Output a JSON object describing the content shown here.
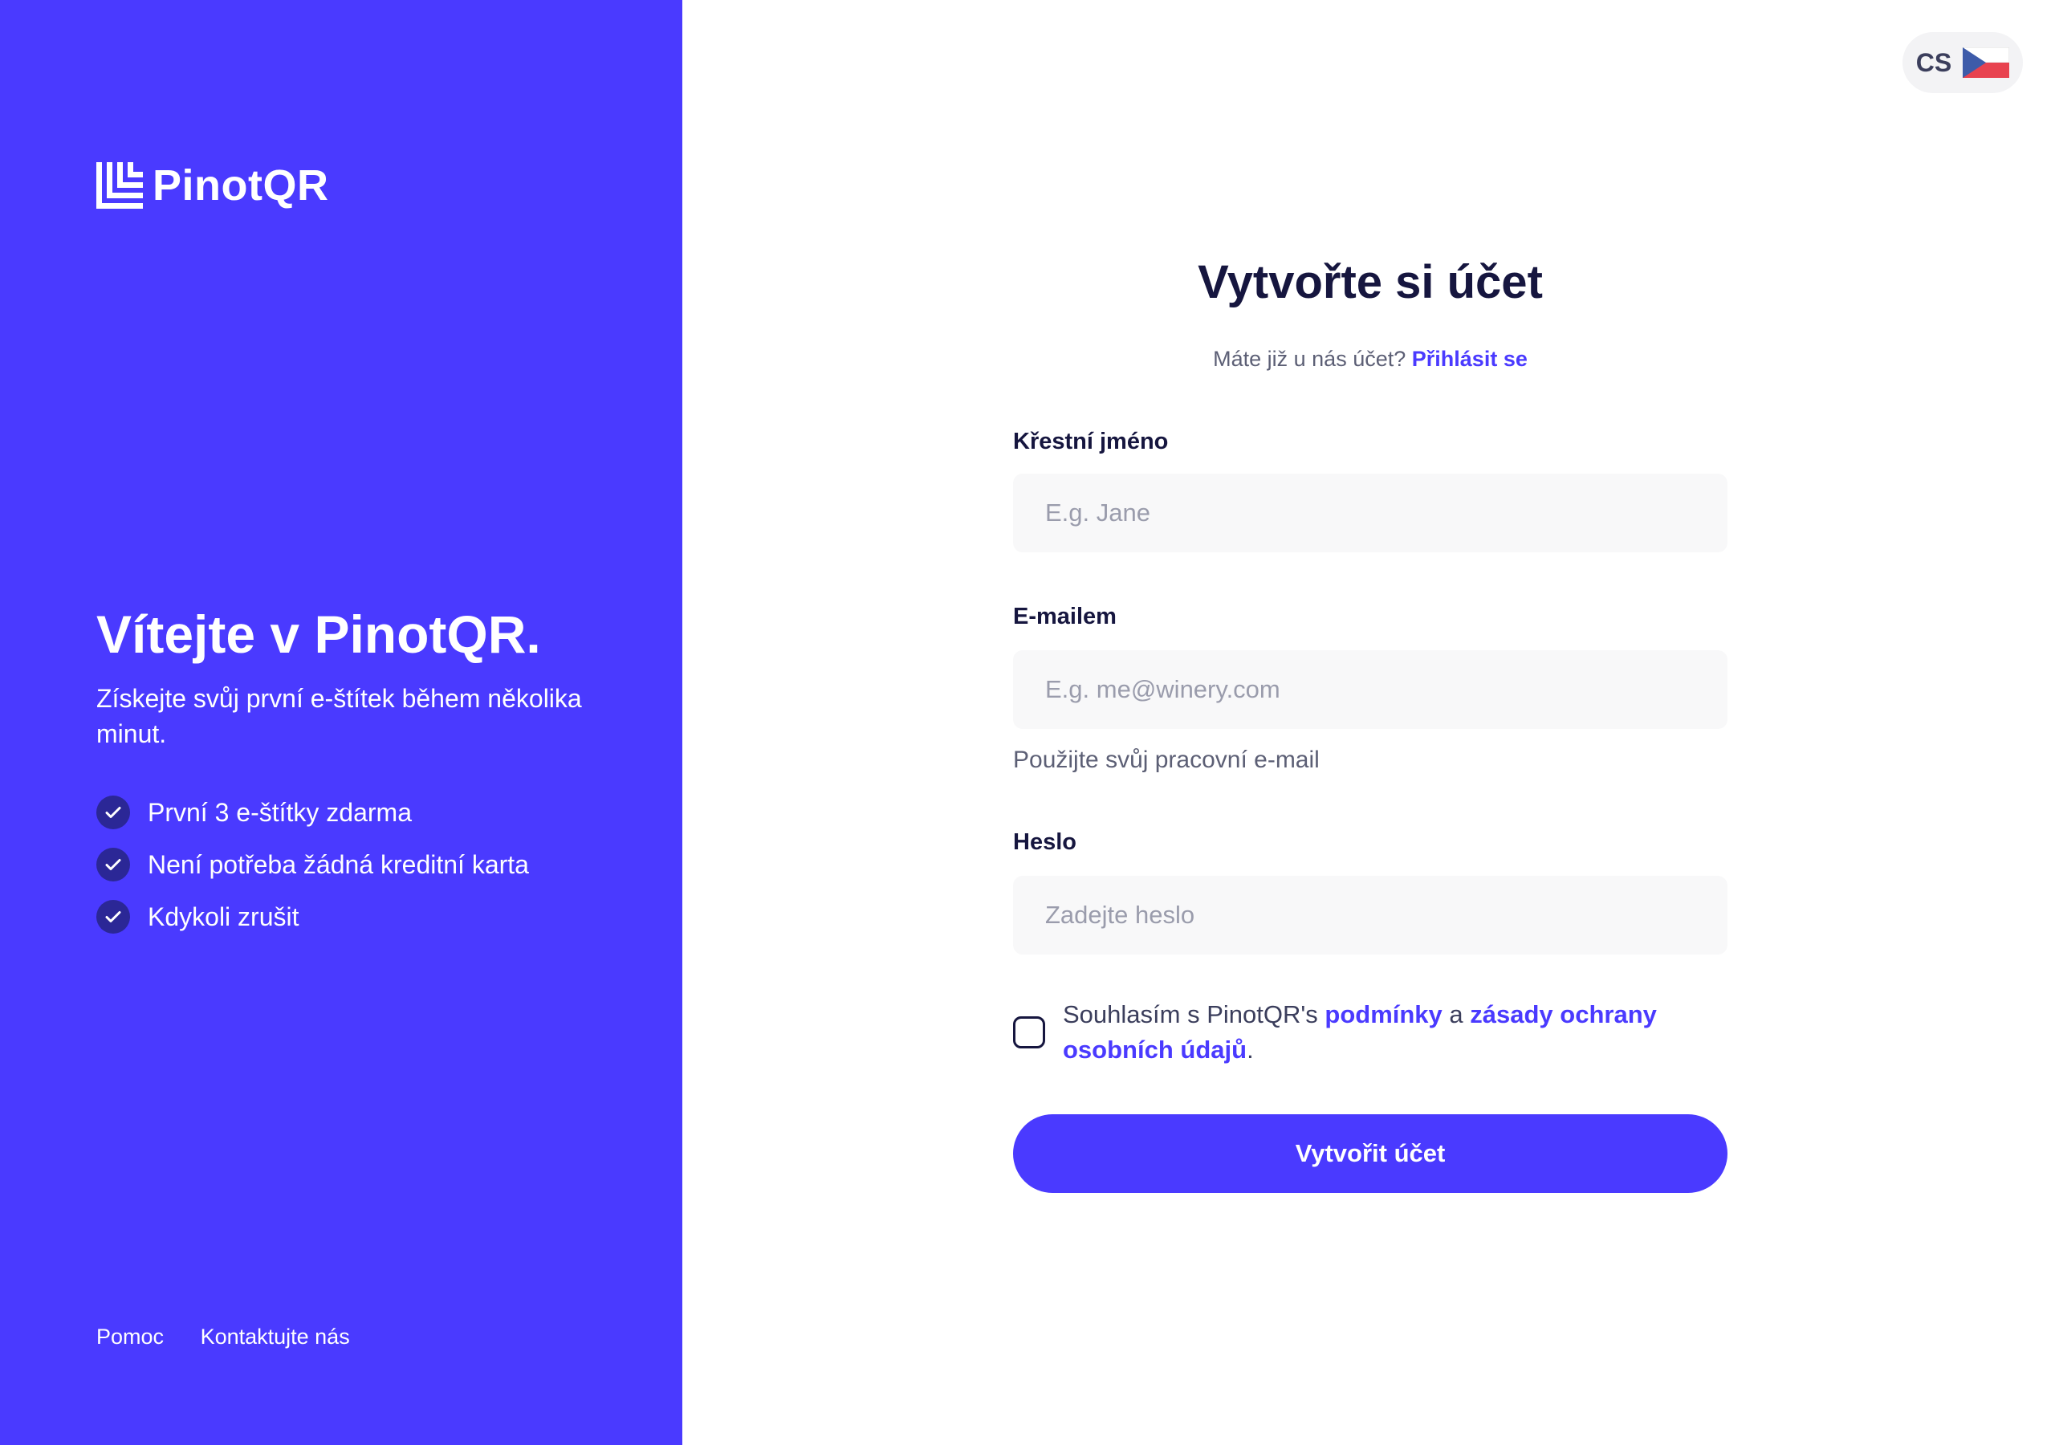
{
  "brand": {
    "name": "PinotQR",
    "color": "#4A3AFF"
  },
  "welcome": {
    "title": "Vítejte v PinotQR.",
    "subtitle": "Získejte svůj první e-štítek během několika minut.",
    "features": [
      "První 3 e-štítky zdarma",
      "Není potřeba žádná kreditní karta",
      "Kdykoli zrušit"
    ]
  },
  "footer": {
    "help": "Pomoc",
    "contact": "Kontaktujte nás"
  },
  "language": {
    "code": "CS",
    "flag": "czech-flag-icon"
  },
  "form": {
    "title": "Vytvořte si účet",
    "have_account": "Máte již u nás účet?",
    "login_link": "Přihlásit se",
    "first_name": {
      "label": "Křestní jméno",
      "placeholder": "E.g. Jane",
      "value": ""
    },
    "email": {
      "label": "E-mailem",
      "placeholder": "E.g. me@winery.com",
      "hint": "Použijte svůj pracovní e-mail",
      "value": ""
    },
    "password": {
      "label": "Heslo",
      "placeholder": "Zadejte heslo",
      "value": ""
    },
    "terms": {
      "checked": false,
      "prefix": "Souhlasím s PinotQR's ",
      "terms_link": "podmínky",
      "conjunction": " a ",
      "privacy_link": "zásady ochrany osobních údajů",
      "suffix": "."
    },
    "submit_label": "Vytvořit účet"
  }
}
